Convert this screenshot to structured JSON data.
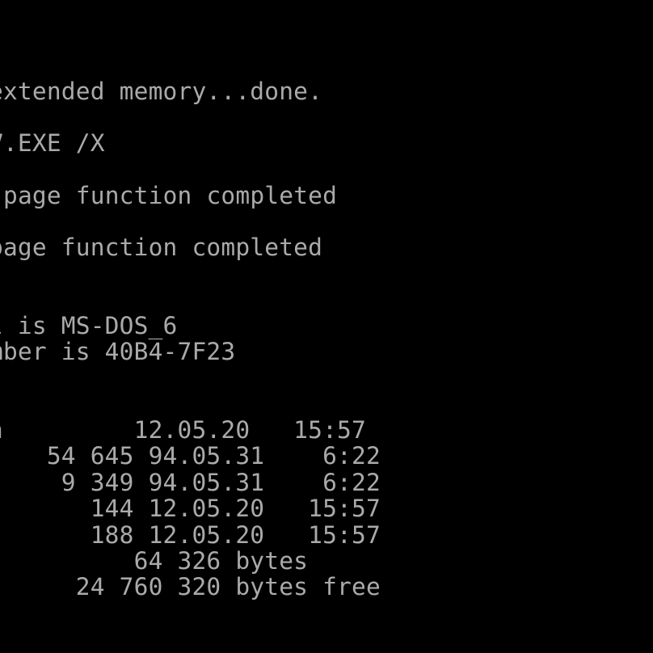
{
  "terminal": {
    "os": "MS-DOS 6",
    "text_color": "#AAAAAA",
    "background_color": "#000000",
    "lines": {
      "himem_status": "extended memory...done.",
      "command_line": "V.EXE /X",
      "function_status_1": "page function completed",
      "function_status_2": "page function completed",
      "volume_label": "l is MS-DOS_6",
      "serial_number": "mber is 40B4-7F23",
      "file_rows": [
        {
          "text": "n         12.05.20   15:57"
        },
        {
          "text": "    54 645 94.05.31    6:22"
        },
        {
          "text": "     9 349 94.05.31    6:22"
        },
        {
          "text": "       144 12.05.20   15:57"
        },
        {
          "text": "       188 12.05.20   15:57"
        }
      ],
      "total_bytes": "          64 326 bytes",
      "free_bytes": "      24 760 320 bytes free"
    },
    "directory": {
      "volume_label": "MS-DOS_6",
      "volume_serial": "40B4-7F23",
      "files": [
        {
          "size": "",
          "date": "12.05.20",
          "time": "15:57"
        },
        {
          "size": "54 645",
          "date": "94.05.31",
          "time": "6:22"
        },
        {
          "size": "9 349",
          "date": "94.05.31",
          "time": "6:22"
        },
        {
          "size": "144",
          "date": "12.05.20",
          "time": "15:57"
        },
        {
          "size": "188",
          "date": "12.05.20",
          "time": "15:57"
        }
      ],
      "total_size": "64 326 bytes",
      "free_space": "24 760 320 bytes free"
    }
  }
}
